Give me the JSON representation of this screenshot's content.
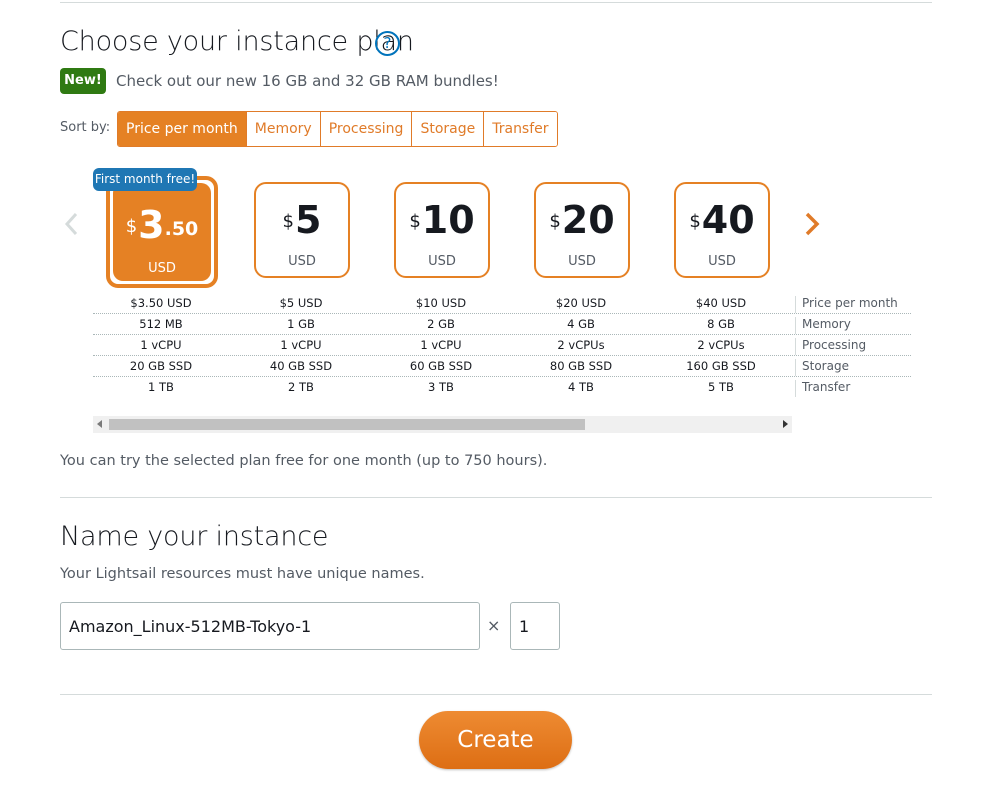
{
  "plan_section": {
    "title": "Choose your instance plan",
    "help_icon": "question-circle-icon",
    "new_badge": "New!",
    "promo_text": "Check out our new 16 GB and 32 GB RAM bundles!",
    "sort_label": "Sort by:",
    "sort_options": [
      "Price per month",
      "Memory",
      "Processing",
      "Storage",
      "Transfer"
    ],
    "sort_selected": "Price per month",
    "free_badge": "First month free!",
    "currency_symbol": "$",
    "selected_cents": ".50",
    "plans": [
      {
        "price_main": "3",
        "unit": "USD",
        "price_text": "$3.50 USD",
        "memory": "512 MB",
        "processing": "1 vCPU",
        "storage": "20 GB SSD",
        "transfer": "1 TB"
      },
      {
        "price_main": "5",
        "unit": "USD",
        "price_text": "$5 USD",
        "memory": "1 GB",
        "processing": "1 vCPU",
        "storage": "40 GB SSD",
        "transfer": "2 TB"
      },
      {
        "price_main": "10",
        "unit": "USD",
        "price_text": "$10 USD",
        "memory": "2 GB",
        "processing": "1 vCPU",
        "storage": "60 GB SSD",
        "transfer": "3 TB"
      },
      {
        "price_main": "20",
        "unit": "USD",
        "price_text": "$20 USD",
        "memory": "4 GB",
        "processing": "2 vCPUs",
        "storage": "80 GB SSD",
        "transfer": "4 TB"
      },
      {
        "price_main": "40",
        "unit": "USD",
        "price_text": "$40 USD",
        "memory": "8 GB",
        "processing": "2 vCPUs",
        "storage": "160 GB SSD",
        "transfer": "5 TB"
      }
    ],
    "row_labels": [
      "Price per month",
      "Memory",
      "Processing",
      "Storage",
      "Transfer"
    ],
    "trial_text": "You can try the selected plan free for one month (up to 750 hours)."
  },
  "name_section": {
    "title": "Name your instance",
    "subtitle": "Your Lightsail resources must have unique names.",
    "instance_name": "Amazon_Linux-512MB-Tokyo-1",
    "multiplier": "×",
    "count": "1"
  },
  "create_button": "Create",
  "colors": {
    "accent": "#e58124",
    "new_badge": "#2f7a12",
    "free_badge": "#1f77b4"
  }
}
